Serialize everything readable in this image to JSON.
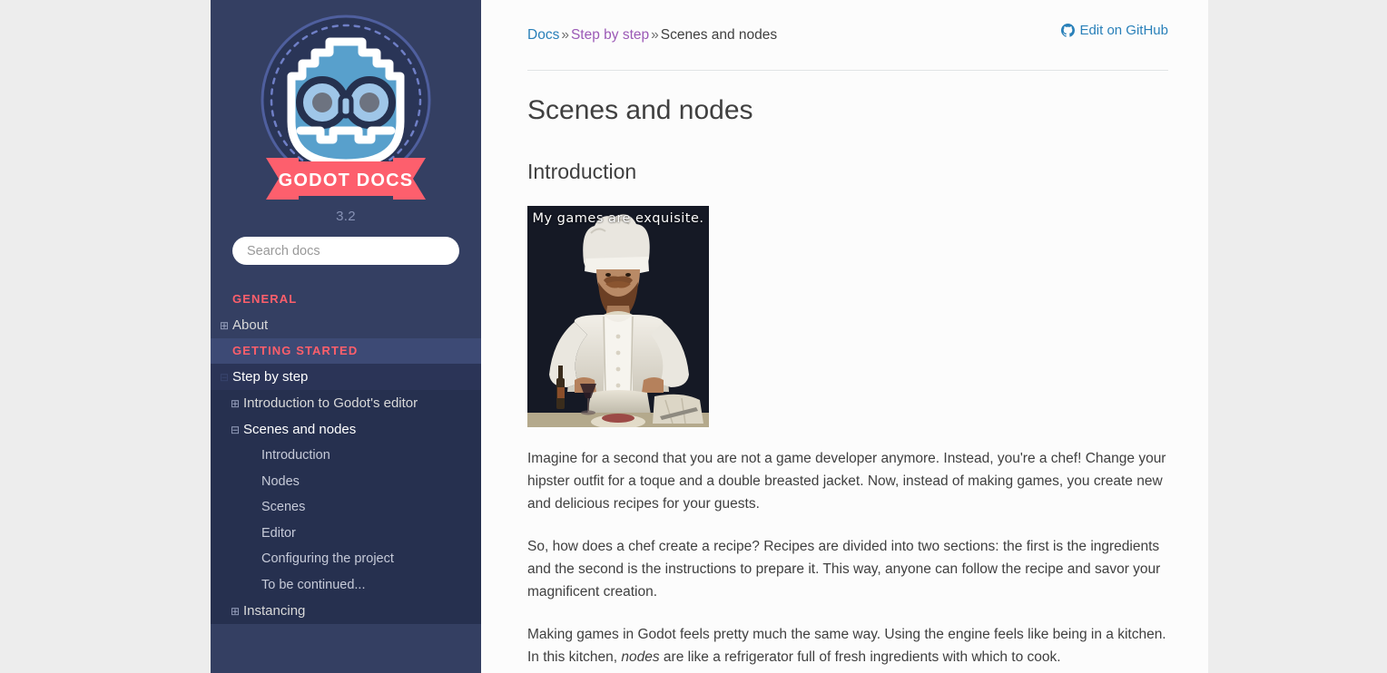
{
  "sidebar": {
    "logo_alt": "Godot Docs",
    "logo_ribbon_text": "GODOT DOCS",
    "version": "3.2",
    "search": {
      "placeholder": "Search docs",
      "value": ""
    },
    "sections": [
      {
        "caption": "GENERAL",
        "highlighted": false,
        "items": [
          {
            "label": "About",
            "toggle": "⊞",
            "level": 1,
            "state": "collapsed"
          }
        ]
      },
      {
        "caption": "GETTING STARTED",
        "highlighted": true,
        "items": [
          {
            "label": "Step by step",
            "toggle": "⊟",
            "level": 1,
            "state": "expanded",
            "active": true
          },
          {
            "label": "Introduction to Godot's editor",
            "toggle": "⊞",
            "level": 2,
            "state": "collapsed"
          },
          {
            "label": "Scenes and nodes",
            "toggle": "⊟",
            "level": 2,
            "state": "expanded",
            "current": true
          },
          {
            "label": "Introduction",
            "toggle": "",
            "level": 3
          },
          {
            "label": "Nodes",
            "toggle": "",
            "level": 3
          },
          {
            "label": "Scenes",
            "toggle": "",
            "level": 3
          },
          {
            "label": "Editor",
            "toggle": "",
            "level": 3
          },
          {
            "label": "Configuring the project",
            "toggle": "",
            "level": 3
          },
          {
            "label": "To be continued...",
            "toggle": "",
            "level": 3
          },
          {
            "label": "Instancing",
            "toggle": "⊞",
            "level": 2,
            "state": "collapsed"
          }
        ]
      }
    ]
  },
  "breadcrumb": {
    "home": "Docs",
    "sep": "»",
    "parent": "Step by step",
    "current": "Scenes and nodes"
  },
  "edit_link": {
    "label": "Edit on GitHub",
    "icon": "github-icon"
  },
  "main": {
    "title": "Scenes and nodes",
    "section_heading": "Introduction",
    "figure": {
      "caption": "My games are exquisite.",
      "alt": "Painting of a chef with meme caption"
    },
    "paragraphs": [
      "Imagine for a second that you are not a game developer anymore. Instead, you're a chef! Change your hipster outfit for a toque and a double breasted jacket. Now, instead of making games, you create new and delicious recipes for your guests.",
      "So, how does a chef create a recipe? Recipes are divided into two sections: the first is the ingredients and the second is the instructions to prepare it. This way, anyone can follow the recipe and savor your magnificent creation."
    ],
    "paragraph3": {
      "before": "Making games in Godot feels pretty much the same way. Using the engine feels like being in a kitchen. In this kitchen, ",
      "emphasis": "nodes",
      "after": " are like a refrigerator full of fresh ingredients with which to cook."
    }
  },
  "colors": {
    "sidebar_bg": "#343f62",
    "sidebar_section_highlight": "#3d4a75",
    "sidebar_group_open": "#26304f",
    "accent_red": "#ff5f6b",
    "link_blue": "#2980b9",
    "link_purple": "#9b59b6",
    "text": "#404040",
    "page_bg": "#ededed",
    "content_bg": "#fcfcfc"
  }
}
